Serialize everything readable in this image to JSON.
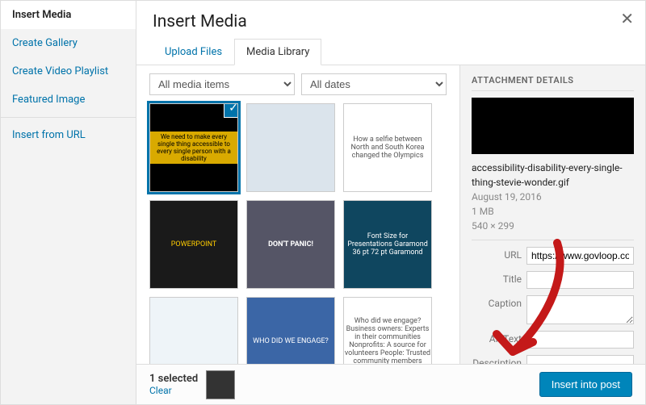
{
  "sidebar": {
    "items": [
      {
        "label": "Insert Media",
        "active": true
      },
      {
        "label": "Create Gallery"
      },
      {
        "label": "Create Video Playlist"
      },
      {
        "label": "Featured Image"
      }
    ],
    "secondary": {
      "label": "Insert from URL"
    }
  },
  "header": {
    "title": "Insert Media"
  },
  "tabs": [
    {
      "label": "Upload Files"
    },
    {
      "label": "Media Library",
      "active": true
    }
  ],
  "filters": {
    "type": "All media items",
    "date": "All dates"
  },
  "thumbs": [
    {
      "caption": "We need to make every single thing accessible to every single person with a disability",
      "selected": true
    },
    {
      "caption": ""
    },
    {
      "caption": "How a selfie between North and South Korea changed the Olympics"
    },
    {
      "caption": "POWERPOINT"
    },
    {
      "caption": "DON'T PANIC!"
    },
    {
      "caption": "Font Size for Presentations  Garamond 36 pt  72 pt  Garamond"
    },
    {
      "caption": ""
    },
    {
      "caption": "WHO DID WE ENGAGE?"
    },
    {
      "caption": "Who did we engage? Business owners: Experts in their communities  Nonprofits: A source for volunteers  People: Trusted community members"
    }
  ],
  "details": {
    "heading": "ATTACHMENT DETAILS",
    "filename": "accessibility-disability-every-single-thing-stevie-wonder.gif",
    "date": "August 19, 2016",
    "size": "1 MB",
    "dims": "540 × 299",
    "fields": {
      "url_label": "URL",
      "url_value": "https://www.govloop.com",
      "title_label": "Title",
      "title_value": "",
      "caption_label": "Caption",
      "caption_value": "",
      "alt_label": "Alt Text",
      "alt_value": "",
      "desc_label": "Description",
      "desc_value": ""
    }
  },
  "footer": {
    "count": "1 selected",
    "clear": "Clear",
    "insert": "Insert into post"
  }
}
